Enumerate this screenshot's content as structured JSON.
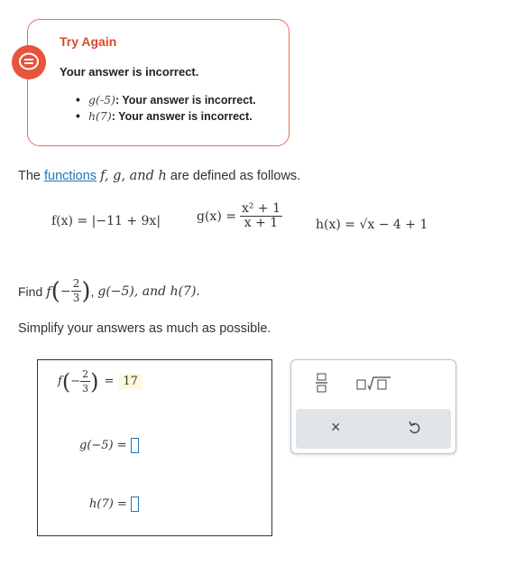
{
  "feedback": {
    "title": "Try Again",
    "message": "Your answer is incorrect.",
    "items": [
      {
        "fn": "g(-5)",
        "text": ": Your answer is incorrect."
      },
      {
        "fn": "h(7)",
        "text": ": Your answer is incorrect."
      }
    ],
    "accent_color": "#e8533b"
  },
  "problem": {
    "intro_prefix": "The ",
    "intro_link": "functions",
    "intro_suffix": " are defined as follows.",
    "vars": "f, g, and h",
    "f_def": "f(x) = |−11 + 9x|",
    "g_def_lhs": "g(x) =",
    "g_def_num": "x² + 1",
    "g_def_den": "x + 1",
    "h_def": "h(x) = √x − 4 + 1",
    "find_label": "Find",
    "find_tail": "g(−5), and h(7).",
    "simplify": "Simplify your answers as much as possible."
  },
  "answers": {
    "f_value": "17",
    "g_label": "g(−5) =",
    "h_label": "h(7) ="
  },
  "palette": {
    "buttons": [
      "fraction-button",
      "sqrt-button"
    ],
    "clear_symbol": "×",
    "undo_symbol": "↺"
  }
}
